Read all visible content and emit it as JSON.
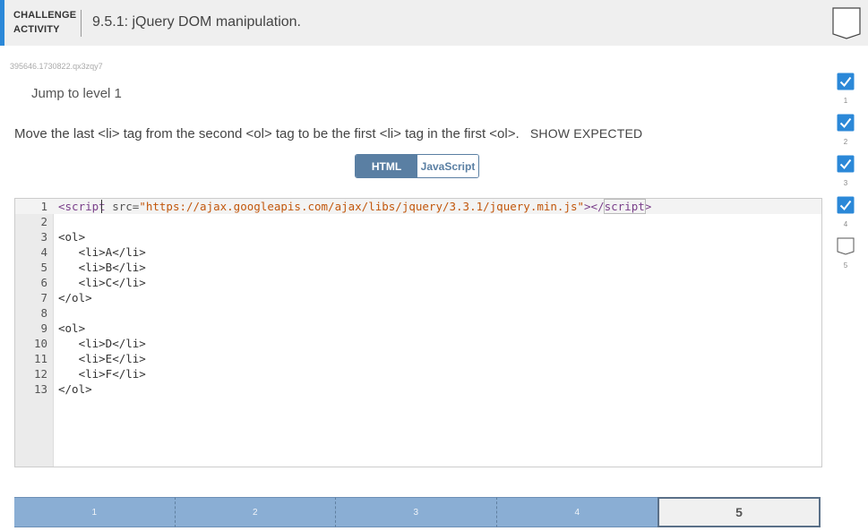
{
  "header": {
    "label_line1": "CHALLENGE",
    "label_line2": "ACTIVITY",
    "title": "9.5.1: jQuery DOM manipulation."
  },
  "activity_id": "395646.1730822.qx3zqy7",
  "jump_link": "Jump to level 1",
  "instructions": {
    "text": "Move the last <li> tag from the second <ol> tag to be the first <li> tag in the first <ol>.",
    "show_expected": "SHOW EXPECTED"
  },
  "toggle": {
    "html_label": "HTML",
    "js_label": "JavaScript",
    "active": "HTML"
  },
  "editor": {
    "line1": {
      "num": "1",
      "open": "<",
      "tag": "script",
      "attr": " src=",
      "str": "\"https://ajax.googleapis.com/ajax/libs/jquery/3.3.1/jquery.min.js\"",
      "close_a": "></",
      "close_tag": "script",
      "close_b": ">"
    },
    "lines": [
      {
        "num": "2",
        "text": ""
      },
      {
        "num": "3",
        "text": "<ol>"
      },
      {
        "num": "4",
        "text": "   <li>A</li>"
      },
      {
        "num": "5",
        "text": "   <li>B</li>"
      },
      {
        "num": "6",
        "text": "   <li>C</li>"
      },
      {
        "num": "7",
        "text": "</ol>"
      },
      {
        "num": "8",
        "text": ""
      },
      {
        "num": "9",
        "text": "<ol>"
      },
      {
        "num": "10",
        "text": "   <li>D</li>"
      },
      {
        "num": "11",
        "text": "   <li>E</li>"
      },
      {
        "num": "12",
        "text": "   <li>F</li>"
      },
      {
        "num": "13",
        "text": "</ol>"
      }
    ]
  },
  "level_progress": [
    {
      "num": "1",
      "completed": true
    },
    {
      "num": "2",
      "completed": true
    },
    {
      "num": "3",
      "completed": true
    },
    {
      "num": "4",
      "completed": true
    },
    {
      "num": "5",
      "completed": false
    }
  ],
  "levels_bar": [
    {
      "label": "1",
      "state": "completed"
    },
    {
      "label": "2",
      "state": "completed"
    },
    {
      "label": "3",
      "state": "completed"
    },
    {
      "label": "4",
      "state": "completed"
    },
    {
      "label": "5",
      "state": "current"
    }
  ],
  "colors": {
    "accent": "#2b88d8",
    "check_blue": "#2b88d8",
    "toggle_active": "#5a7fa3",
    "level_completed": "#8aaed4",
    "level_current_border": "#5a7088"
  }
}
